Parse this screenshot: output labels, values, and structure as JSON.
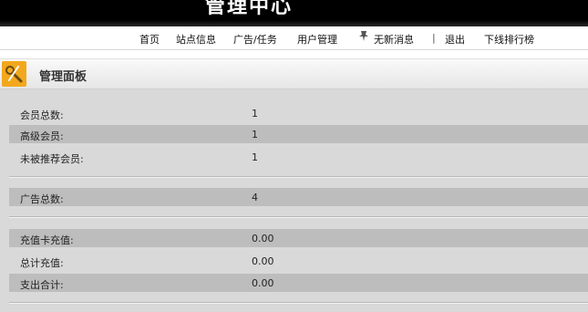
{
  "header": {
    "title": "管理中心",
    "bg_color": "#000000"
  },
  "nav": {
    "items": [
      {
        "label": "首页"
      },
      {
        "label": "站点信息"
      },
      {
        "label": "广告/任务"
      },
      {
        "label": "用户管理"
      },
      {
        "label": "无新消息",
        "icon": "pin-icon"
      },
      {
        "label": "|"
      },
      {
        "label": "退出"
      },
      {
        "label": "下线排行榜"
      }
    ]
  },
  "panel": {
    "title": "管理面板",
    "icon": "tools-icon",
    "icon_color": "#f2a81c",
    "groups": [
      {
        "rows": [
          {
            "label": "会员总数:",
            "value": "1"
          },
          {
            "label": "高级会员:",
            "value": "1"
          },
          {
            "label": "未被推荐会员:",
            "value": "1"
          }
        ]
      },
      {
        "rows": [
          {
            "label": "广告总数:",
            "value": "4"
          }
        ]
      },
      {
        "rows": [
          {
            "label": "充值卡充值:",
            "value": "0.00"
          },
          {
            "label": "总计充值:",
            "value": "0.00"
          },
          {
            "label": "支出合计:",
            "value": "0.00"
          }
        ]
      }
    ]
  }
}
